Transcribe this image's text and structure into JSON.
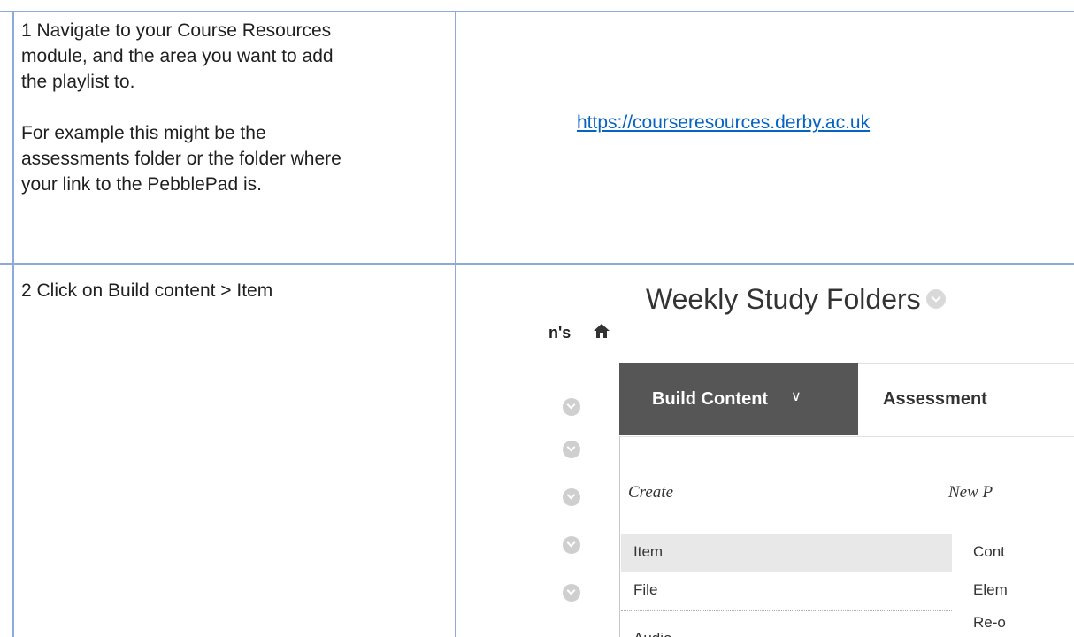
{
  "row1": {
    "step_text_lines": [
      "1 Navigate to your Course Resources",
      "module, and the area you want to add",
      "the playlist to."
    ],
    "example_lines": [
      "For example this might be the",
      "assessments folder or the folder where",
      "your link to the PebblePad is."
    ],
    "link": "https://courseresources.derby.ac.uk"
  },
  "row2": {
    "step_text": "2 Click on Build content > Item"
  },
  "screenshot": {
    "crumb": "n's",
    "title": "Weekly Study Folders",
    "build_label": "Build Content",
    "build_chevron": "∨",
    "assess_label": "Assessment",
    "create_header": "Create",
    "new_page_header": "New P",
    "items_col1": [
      "Item",
      "File",
      "Audio"
    ],
    "items_col2": [
      "Cont",
      "Elem",
      "Re-o"
    ]
  },
  "colors": {
    "rule": "#8eaadb",
    "link": "#0563c1",
    "build_bg": "#565656"
  },
  "icons": [
    "home-icon",
    "chevron-down-icon"
  ]
}
